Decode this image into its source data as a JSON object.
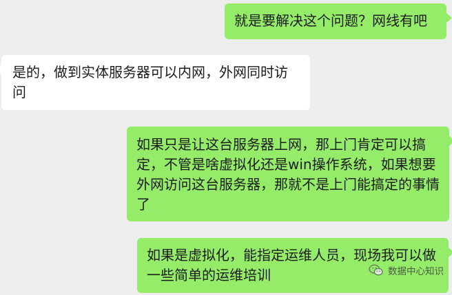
{
  "conversation": {
    "messages": [
      {
        "role": "sent",
        "text": "就是要解决这个问题？网线有吧"
      },
      {
        "role": "received",
        "text": "是的，做到实体服务器可以内网，外网同时访问"
      },
      {
        "role": "sent",
        "text": "如果只是让这台服务器上网，那上门肯定可以搞定，不管是啥虚拟化还是win操作系统，如果想要外网访问这台服务器，那就不是上门能搞定的事情了"
      },
      {
        "role": "sent",
        "text": "如果是虚拟化，能指定运维人员，现场我可以做一些简单的运维培训"
      }
    ]
  },
  "watermark": {
    "icon": "wechat-icon",
    "label": "数据中心知识"
  },
  "colors": {
    "background": "#ededed",
    "sent_bubble": "#95ec69",
    "received_bubble": "#ffffff",
    "text": "#1b1b1b"
  }
}
